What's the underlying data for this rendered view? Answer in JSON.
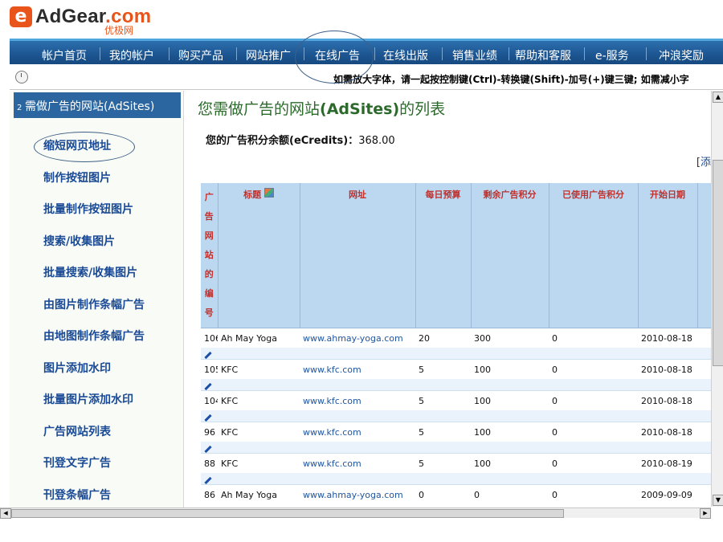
{
  "logo": {
    "mark": "e",
    "name": "AdGear",
    "tld": ".com",
    "sub": "优极网"
  },
  "nav": {
    "items": [
      "帐户首页",
      "我的帐户",
      "购买产品",
      "网站推广",
      "在线广告",
      "在线出版",
      "销售业绩",
      "帮助和客服",
      "e-服务",
      "冲浪奖励"
    ]
  },
  "notice": "如需放大字体，请一起按控制键(Ctrl)-转换键(Shift)-加号(+)键三键; 如需减小字",
  "sidebar": {
    "header_num": "2",
    "header": "需做广告的网站(AdSites)",
    "links": [
      "缩短网页地址",
      "制作按钮图片",
      "批量制作按钮图片",
      "搜索/收集图片",
      "批量搜索/收集图片",
      "由图片制作条幅广告",
      "由地图制作条幅广告",
      "图片添加水印",
      "批量图片添加水印",
      "广告网站列表",
      "刊登文字广告",
      "刊登条幅广告"
    ]
  },
  "main": {
    "title_prefix": "您需做广告的网站",
    "title_bold": "(AdSites)",
    "title_suffix": "的列表",
    "credits_label": "您的广告积分余额(eCredits)：",
    "credits_value": "368.00",
    "bracket_open": "[",
    "bracket_link": "添"
  },
  "table": {
    "id_header": [
      "广",
      "告",
      "网",
      "站",
      "的",
      "编",
      "号"
    ],
    "headers": [
      "标题",
      "网址",
      "每日预算",
      "剩余广告积分",
      "已使用广告积分",
      "开始日期"
    ],
    "rows": [
      {
        "id": "106",
        "title": "Ah May Yoga",
        "url": "www.ahmay-yoga.com",
        "budget": "20",
        "remaining": "300",
        "used": "0",
        "start": "2010-08-18"
      },
      {
        "id": "105",
        "title": "KFC",
        "url": "www.kfc.com",
        "budget": "5",
        "remaining": "100",
        "used": "0",
        "start": "2010-08-18"
      },
      {
        "id": "104",
        "title": "KFC",
        "url": "www.kfc.com",
        "budget": "5",
        "remaining": "100",
        "used": "0",
        "start": "2010-08-18"
      },
      {
        "id": "96",
        "title": "KFC",
        "url": "www.kfc.com",
        "budget": "5",
        "remaining": "100",
        "used": "0",
        "start": "2010-08-18"
      },
      {
        "id": "88",
        "title": "KFC",
        "url": "www.kfc.com",
        "budget": "5",
        "remaining": "100",
        "used": "0",
        "start": "2010-08-19"
      },
      {
        "id": "86",
        "title": "Ah May Yoga",
        "url": "www.ahmay-yoga.com",
        "budget": "0",
        "remaining": "0",
        "used": "0",
        "start": "2009-09-09"
      }
    ]
  },
  "icons": {
    "clock": "clock-icon",
    "edit": "pencil-icon",
    "sort": "sort-icon"
  },
  "colors": {
    "nav_bg": "#1c5591",
    "sidebar_header": "#2b66a0",
    "title": "#2c6a2c",
    "header_text": "#c0302c",
    "link": "#1a4a96",
    "logo_accent": "#e8541a"
  }
}
